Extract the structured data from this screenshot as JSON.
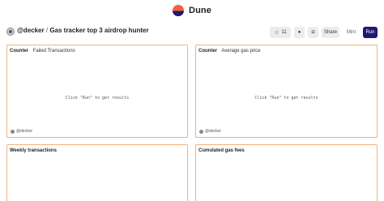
{
  "brand": {
    "name": "Dune"
  },
  "header": {
    "owner": "@decker",
    "separator": "/",
    "dashboard_title": "Gas tracker top 3 airdrop hunter"
  },
  "toolbar": {
    "star_count": "11",
    "share_label": "Share",
    "mint_label": "Mint",
    "run_label": "Run"
  },
  "panels": [
    {
      "kind": "Counter",
      "name": "Failed Transactions",
      "placeholder": "Click \"Run\" to get results",
      "owner": "@decker"
    },
    {
      "kind": "Counter",
      "name": "Average gas price",
      "placeholder": "Click \"Run\" to get results",
      "owner": "@decker"
    },
    {
      "kind": "",
      "name": "Weekly transactions"
    },
    {
      "kind": "",
      "name": "Cumulated gas fees"
    }
  ],
  "colors": {
    "accent": "#1e1870",
    "panel_border": "#f0b27a",
    "button_bg": "#ececec"
  },
  "icons": [
    "dune-logo-icon",
    "star-icon",
    "github-icon",
    "camera-icon"
  ]
}
